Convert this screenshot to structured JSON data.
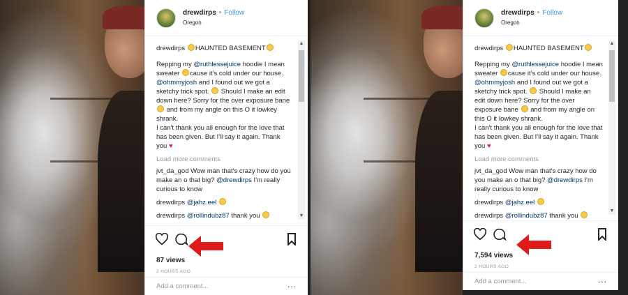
{
  "posts": [
    {
      "username": "drewdirps",
      "follow_label": "Follow",
      "location": "Oregon",
      "caption_title": "HAUNTED BASEMENT",
      "caption_lines": [
        "Repping my ",
        "@ruthlessejuice",
        " hoodie I mean sweater ",
        "cause it's cold under our house. ",
        "@ohmmyjosh",
        " and I found out we got a sketchy trick spot. "
      ],
      "caption_rest_1": "Should I make an edit down here? Sorry for the over exposure bane ",
      "caption_rest_2": " and from my angle on this O it lowkey shrank.",
      "caption_rest_3": "I can't thank you all enough for the love that has been given. But I'll say it again. Thank you ",
      "load_more": "Load more comments",
      "comment1_user": "jvt_da_god",
      "comment1_text": " Wow man that's crazy how do you make an o that big? ",
      "comment1_mention": "@drewdirps",
      "comment1_tail": " I'm really curious to know",
      "comment2_user": "drewdirps",
      "comment2_mention": "@jahz.eel",
      "comment3_user": "drewdirps",
      "comment3_mention": "@rollindubz87",
      "comment3_text": " thank you ",
      "views": "87 views",
      "time": "2 HOURS AGO",
      "add_comment_placeholder": "Add a comment...",
      "more": "..."
    },
    {
      "username": "drewdirps",
      "follow_label": "Follow",
      "location": "Oregon",
      "caption_title": "HAUNTED BASEMENT",
      "load_more": "Load more comments",
      "comment1_user": "jvt_da_god",
      "comment2_user": "drewdirps",
      "comment2_mention": "@jahz.eel",
      "comment3_user": "drewdirps",
      "comment3_mention": "@rollindubz87",
      "comment3_text": " thank you ",
      "views": "7,594 views",
      "time": "2 HOURS AGO",
      "add_comment_placeholder": "Add a comment...",
      "more": "..."
    }
  ],
  "colors": {
    "link": "#3897f0",
    "arrow": "#e01b1b",
    "heart": "#e0245e"
  },
  "icons": [
    "heart-icon",
    "comment-icon",
    "bookmark-icon",
    "red-arrow-icon",
    "emoji-icon"
  ]
}
